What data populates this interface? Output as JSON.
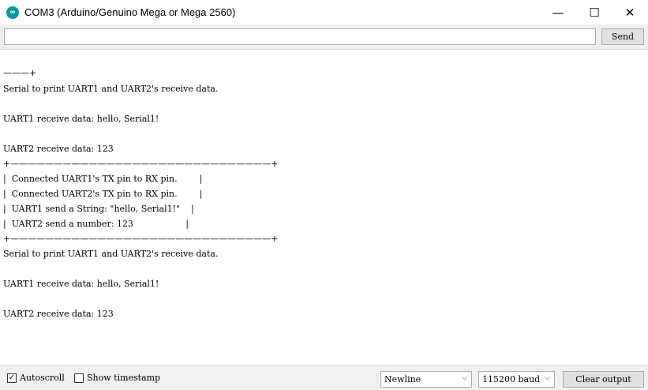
{
  "window": {
    "title": "COM3 (Arduino/Genuino Mega or Mega 2560)",
    "minimize_glyph": "—",
    "maximize_glyph": "☐",
    "close_glyph": "✕",
    "app_icon": "arduino-logo-icon"
  },
  "input_row": {
    "value": "",
    "send_label": "Send"
  },
  "output": {
    "lines": [
      "———+",
      "Serial to print UART1 and UART2's receive data.",
      "UART1 receive data: hello, Serial1!",
      "UART2 receive data: 123",
      "+——————————————————————————————+",
      "|  Connected UART1's TX pin to RX pin.        |",
      "|  Connected UART2's TX pin to RX pin.        |",
      "|  UART1 send a String: \"hello, Serial1!\"    |",
      "|  UART2 send a number: 123                   |",
      "+——————————————————————————————+",
      "Serial to print UART1 and UART2's receive data.",
      "UART1 receive data: hello, Serial1!",
      "UART2 receive data: 123"
    ]
  },
  "bottom_bar": {
    "autoscroll_label": "Autoscroll",
    "autoscroll_checked": true,
    "timestamp_label": "Show timestamp",
    "timestamp_checked": false,
    "line_ending": "Newline",
    "baud_rate": "115200 baud",
    "clear_label": "Clear output"
  },
  "colors": {
    "app_icon": "#00979c",
    "background": "#f0f0f0",
    "output_background": "#ffffff"
  }
}
